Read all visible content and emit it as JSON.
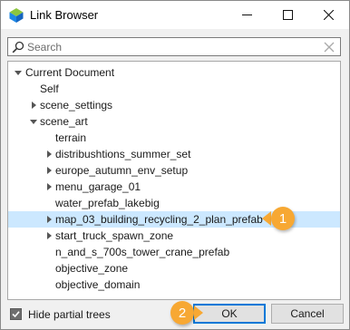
{
  "window": {
    "title": "Link Browser"
  },
  "search": {
    "placeholder": "Search",
    "value": ""
  },
  "tree": {
    "root": "Current Document",
    "items": [
      "Self",
      "scene_settings",
      "scene_art",
      "terrain",
      "distribushtions_summer_set",
      "europe_autumn_env_setup",
      "menu_garage_01",
      "water_prefab_lakebig",
      "map_03_building_recycling_2_plan_prefab",
      "start_truck_spawn_zone",
      "n_and_s_700s_tower_crane_prefab",
      "objective_zone",
      "objective_domain"
    ]
  },
  "options": {
    "hide_partial_trees_label": "Hide partial trees",
    "hide_partial_trees_checked": true
  },
  "buttons": {
    "ok": "OK",
    "cancel": "Cancel"
  },
  "annotations": {
    "step1": "1",
    "step2": "2"
  },
  "colors": {
    "accent": "#0078d7",
    "selection": "#cce8ff",
    "marker": "#f7a833"
  }
}
